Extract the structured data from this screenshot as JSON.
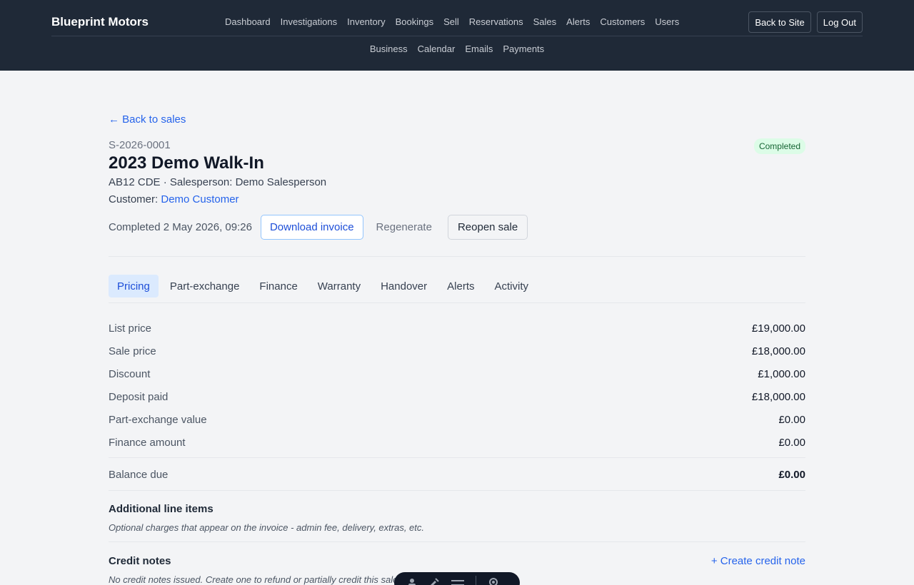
{
  "app": {
    "brand": "Blueprint Motors"
  },
  "nav": {
    "primary": [
      "Dashboard",
      "Investigations",
      "Inventory",
      "Bookings",
      "Sell",
      "Reservations",
      "Sales",
      "Alerts",
      "Customers",
      "Users"
    ],
    "secondary": [
      "Business",
      "Calendar",
      "Emails",
      "Payments"
    ],
    "back_to_site": "Back to Site",
    "log_out": "Log Out"
  },
  "sale": {
    "back_link": "← Back to sales",
    "id": "S-2026-0001",
    "status": "Completed",
    "title": "2023 Demo Walk-In",
    "subline": "AB12 CDE · Salesperson: Demo Salesperson",
    "customer_label": "Customer:",
    "customer_name": "Demo Customer",
    "completed_text": "Completed 2 May 2026, 09:26",
    "download_invoice": "Download invoice",
    "regenerate": "Regenerate",
    "reopen_sale": "Reopen sale"
  },
  "tabs": [
    "Pricing",
    "Part-exchange",
    "Finance",
    "Warranty",
    "Handover",
    "Alerts",
    "Activity"
  ],
  "pricing": {
    "rows": [
      {
        "label": "List price",
        "value": "£19,000.00"
      },
      {
        "label": "Sale price",
        "value": "£18,000.00"
      },
      {
        "label": "Discount",
        "value": "£1,000.00"
      },
      {
        "label": "Deposit paid",
        "value": "£18,000.00"
      },
      {
        "label": "Part-exchange value",
        "value": "£0.00"
      },
      {
        "label": "Finance amount",
        "value": "£0.00"
      }
    ],
    "balance_label": "Balance due",
    "balance_value": "£0.00"
  },
  "line_items": {
    "title": "Additional line items",
    "note": "Optional charges that appear on the invoice - admin fee, delivery, extras, etc."
  },
  "credit_notes": {
    "title": "Credit notes",
    "create_link": "+ Create credit note",
    "note": "No credit notes issued. Create one to refund or partially credit this sale."
  },
  "colors": {
    "header_bg": "#1f2937",
    "accent": "#2563eb",
    "badge_bg": "#dcfce7",
    "badge_text": "#166534"
  }
}
